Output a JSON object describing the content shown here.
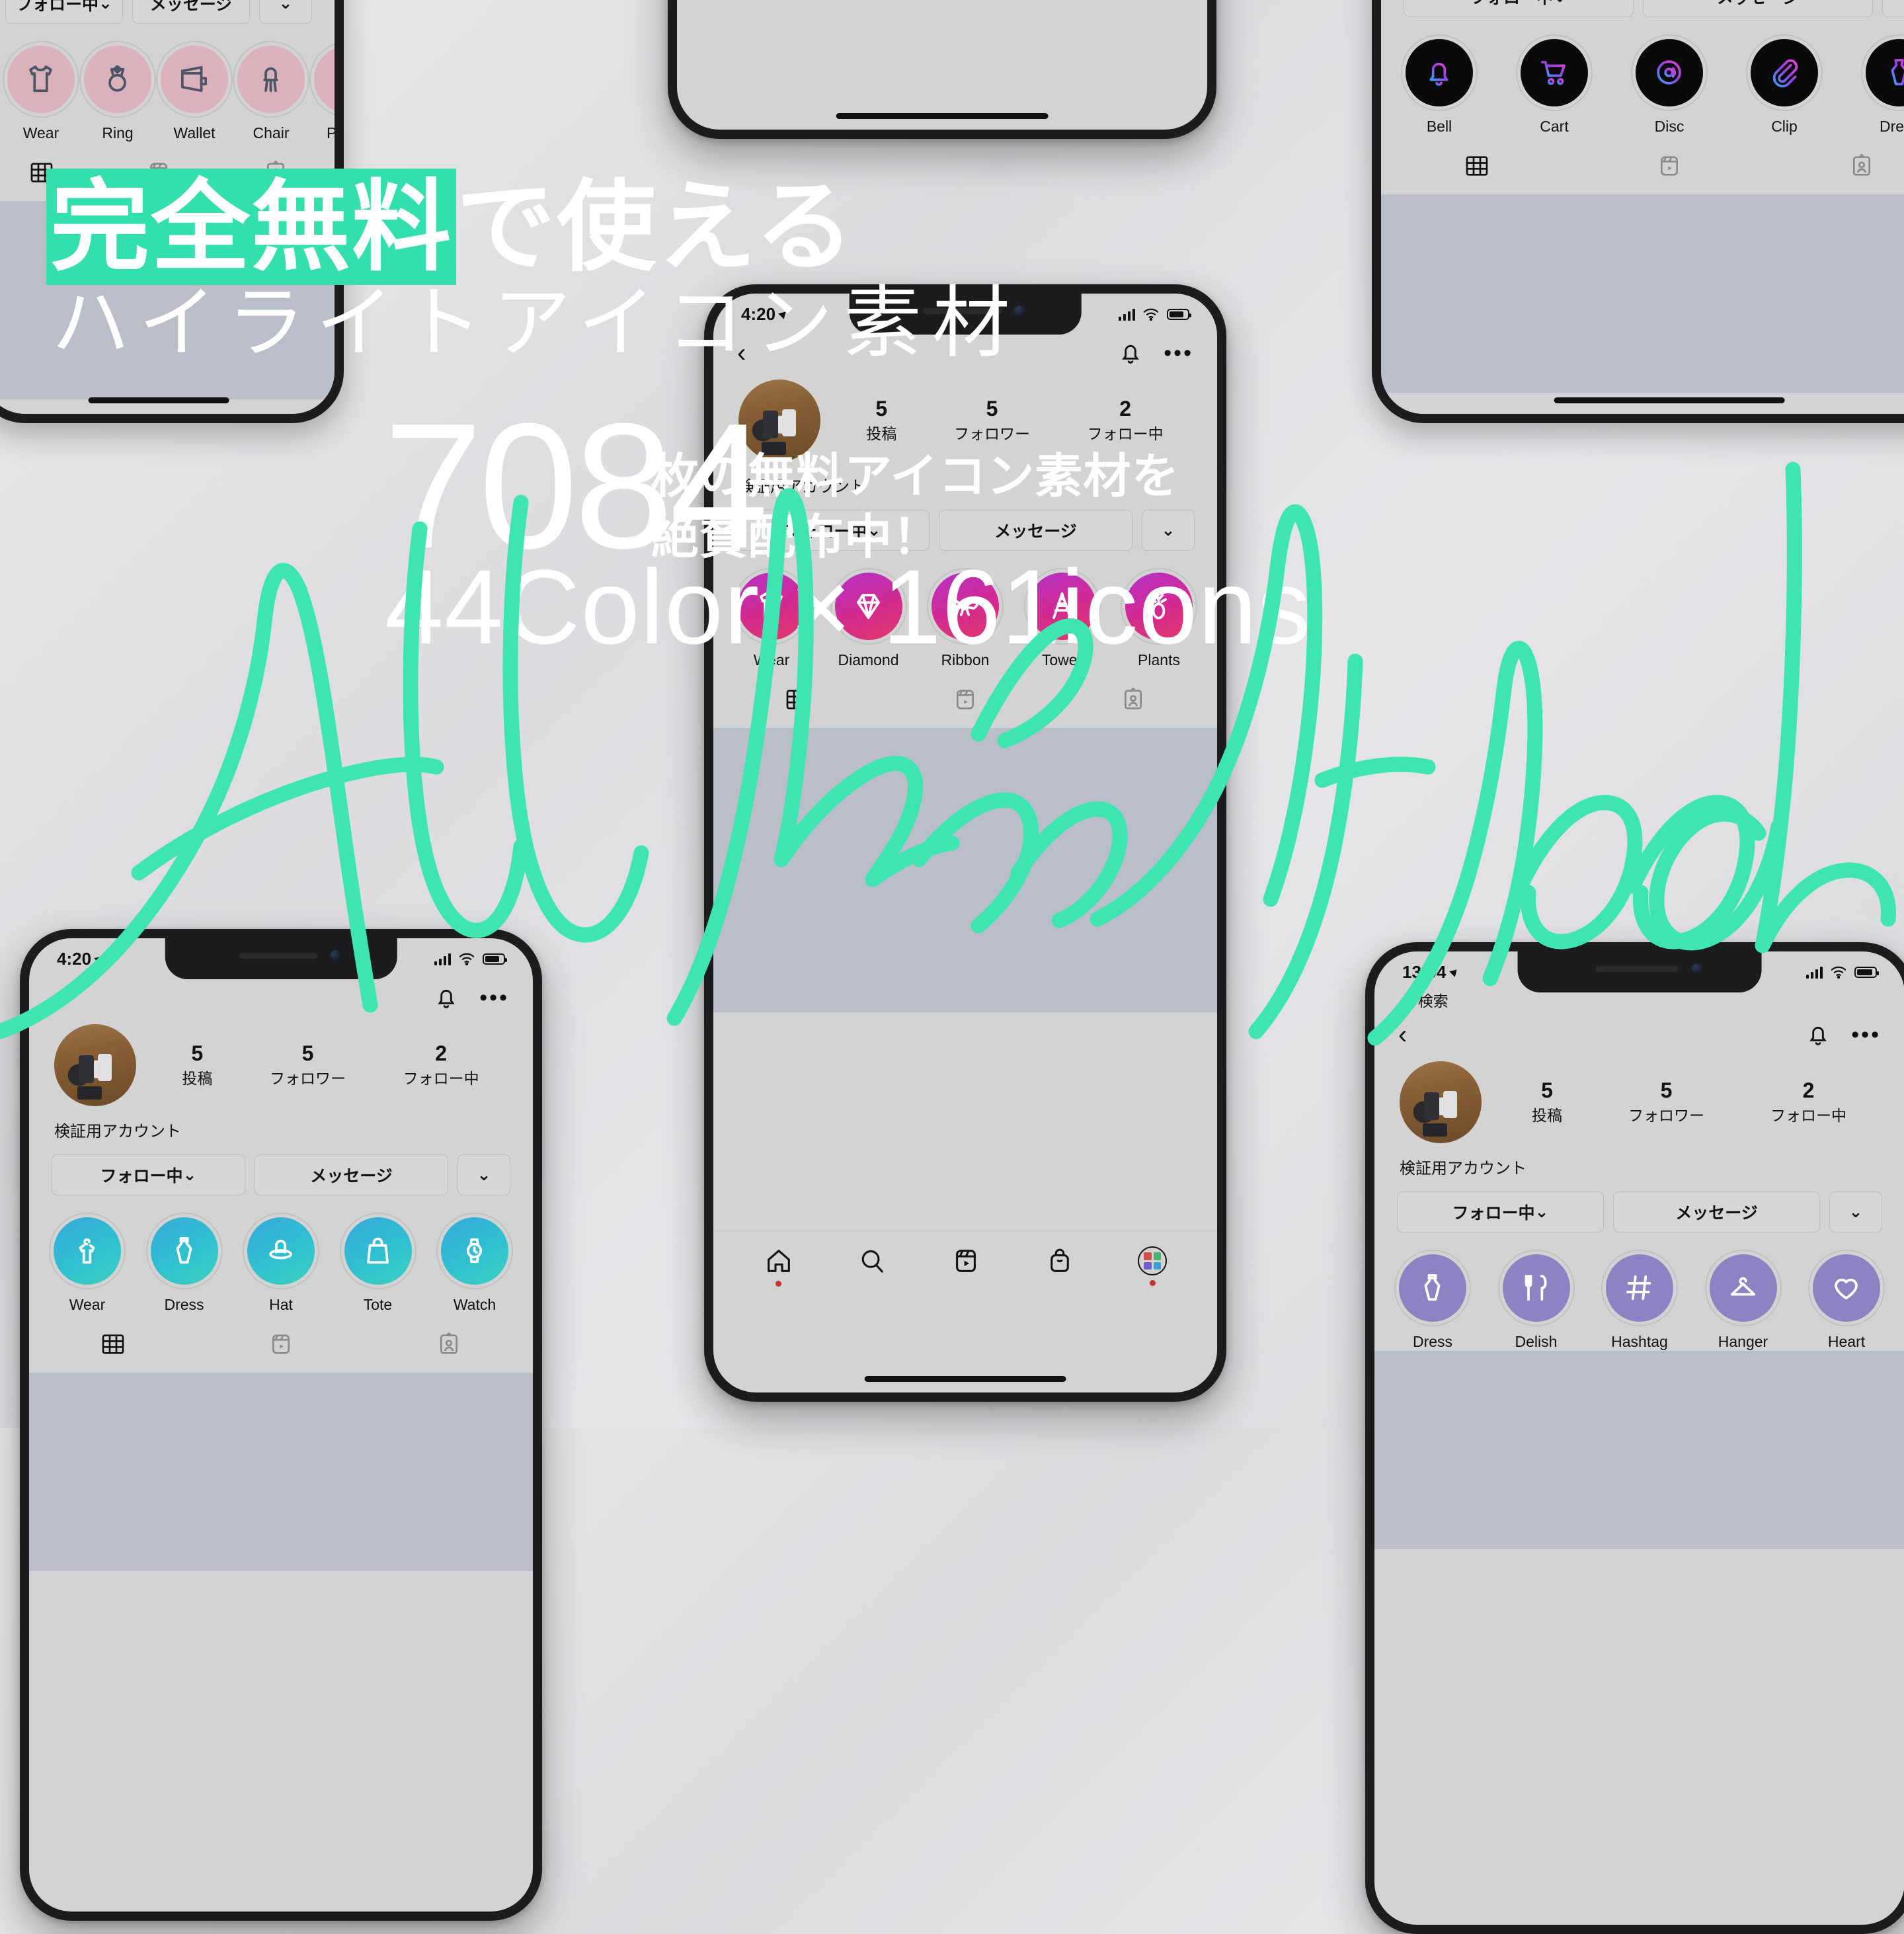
{
  "brand": {
    "accent": "#33e0ad",
    "headline_part1": "完全無料",
    "headline_part2": "で使える",
    "headline_line2": "ハイライトアイコン素材",
    "big_number": "7084",
    "big_sub": "44Color × 161icons",
    "right_text_line1": "枚の無料アイコン素材を",
    "right_text_line2": "絶賛配布中！",
    "script_text": "All free download"
  },
  "profile": {
    "username": "検証用アカウント",
    "stats": [
      {
        "number": "5",
        "label": "投稿"
      },
      {
        "number": "5",
        "label": "フォロワー"
      },
      {
        "number": "2",
        "label": "フォロー中"
      }
    ],
    "buttons": {
      "following": "フォロー中",
      "following_caret": "⌄",
      "message": "メッセージ",
      "more_caret": "⌄"
    }
  },
  "status_bars": {
    "time_a": "4:20",
    "time_b": "13:04",
    "back_label": "検索"
  },
  "phones": [
    {
      "id": "top-left",
      "theme_name": "pink-soft",
      "circle_color": "#dbb2bb",
      "icon_color": "#4c5566",
      "highlights": [
        {
          "label": "Wear",
          "icon": "tshirt-icon"
        },
        {
          "label": "Ring",
          "icon": "ring-icon"
        },
        {
          "label": "Wallet",
          "icon": "wallet-icon"
        },
        {
          "label": "Chair",
          "icon": "chair-icon"
        },
        {
          "label": "Plants",
          "icon": "pineapple-plant-icon"
        }
      ]
    },
    {
      "id": "top-right",
      "theme_name": "black-neon",
      "circle_color": "#0a0a0a",
      "icon_color": "gradient-blue-purple",
      "highlights": [
        {
          "label": "Bell",
          "icon": "bell-icon"
        },
        {
          "label": "Cart",
          "icon": "cart-icon"
        },
        {
          "label": "Disc",
          "icon": "disc-icon"
        },
        {
          "label": "Clip",
          "icon": "paperclip-icon"
        },
        {
          "label": "Dress",
          "icon": "dress-icon"
        }
      ]
    },
    {
      "id": "center",
      "theme_name": "magenta-gradient",
      "circle_color": "gradient-magenta",
      "icon_color": "#ffffff",
      "highlights": [
        {
          "label": "Wear",
          "icon": "tshirt-icon"
        },
        {
          "label": "Diamond",
          "icon": "diamond-icon"
        },
        {
          "label": "Ribbon",
          "icon": "ribbon-icon"
        },
        {
          "label": "Tower",
          "icon": "tower-icon"
        },
        {
          "label": "Plants",
          "icon": "pineapple-plant-icon"
        }
      ]
    },
    {
      "id": "bottom-left",
      "theme_name": "cyan-gradient",
      "circle_color": "gradient-cyan",
      "icon_color": "#ffffff",
      "highlights": [
        {
          "label": "Wear",
          "icon": "hanger-shirt-icon"
        },
        {
          "label": "Dress",
          "icon": "dress-icon"
        },
        {
          "label": "Hat",
          "icon": "hat-icon"
        },
        {
          "label": "Tote",
          "icon": "tote-icon"
        },
        {
          "label": "Watch",
          "icon": "watch-icon"
        }
      ]
    },
    {
      "id": "bottom-right",
      "theme_name": "purple-solid",
      "circle_color": "#8d83c2",
      "icon_color": "#ffffff",
      "highlights": [
        {
          "label": "Dress",
          "icon": "dress-icon"
        },
        {
          "label": "Delish",
          "icon": "fork-knife-icon"
        },
        {
          "label": "Hashtag",
          "icon": "hashtag-icon"
        },
        {
          "label": "Hanger",
          "icon": "hanger-icon"
        },
        {
          "label": "Heart",
          "icon": "heart-icon"
        }
      ]
    }
  ],
  "bottom_nav": [
    {
      "name": "home",
      "icon": "home-icon",
      "badge": true
    },
    {
      "name": "search",
      "icon": "search-icon",
      "badge": false
    },
    {
      "name": "reels",
      "icon": "reels-icon",
      "badge": false
    },
    {
      "name": "shop",
      "icon": "shop-bag-icon",
      "badge": false
    },
    {
      "name": "profile",
      "icon": "profile-avatar-icon",
      "badge": true
    }
  ],
  "profile_tabs": [
    {
      "name": "grid",
      "icon": "grid-icon"
    },
    {
      "name": "reels",
      "icon": "reels-icon"
    },
    {
      "name": "tagged",
      "icon": "tagged-icon"
    }
  ]
}
